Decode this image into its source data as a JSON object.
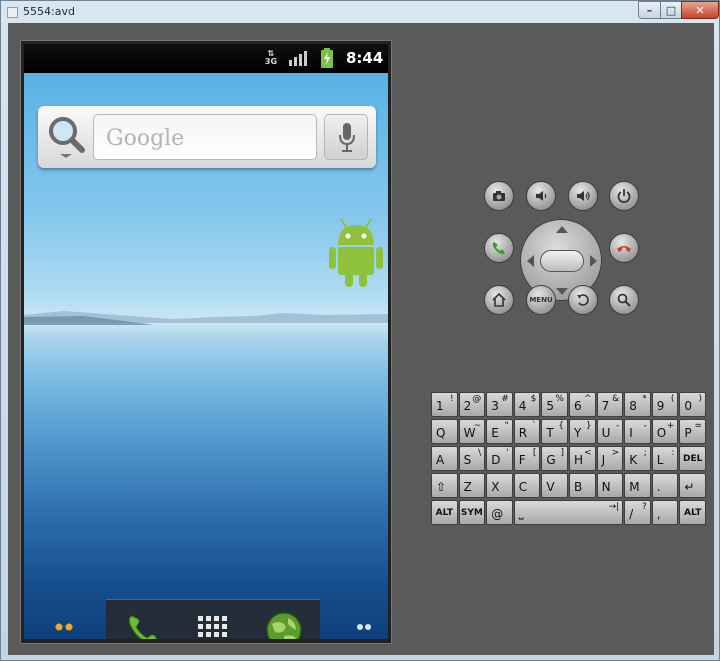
{
  "window": {
    "title": "5554:avd",
    "controls": {
      "minimize": "–",
      "maximize": "□",
      "close": "✕"
    }
  },
  "statusbar": {
    "network": "3G",
    "time": "8:44"
  },
  "search_widget": {
    "placeholder": "Google"
  },
  "hardware_buttons": {
    "menu_label": "MENU"
  },
  "keyboard": {
    "rows": [
      [
        {
          "k": "1",
          "a": "!"
        },
        {
          "k": "2",
          "a": "@"
        },
        {
          "k": "3",
          "a": "#"
        },
        {
          "k": "4",
          "a": "$"
        },
        {
          "k": "5",
          "a": "%"
        },
        {
          "k": "6",
          "a": "^"
        },
        {
          "k": "7",
          "a": "&"
        },
        {
          "k": "8",
          "a": "*"
        },
        {
          "k": "9",
          "a": "("
        },
        {
          "k": "0",
          "a": ")"
        }
      ],
      [
        {
          "k": "Q",
          "a": ""
        },
        {
          "k": "W",
          "a": "~"
        },
        {
          "k": "E",
          "a": "\""
        },
        {
          "k": "R",
          "a": "`"
        },
        {
          "k": "T",
          "a": "{"
        },
        {
          "k": "Y",
          "a": "}"
        },
        {
          "k": "U",
          "a": "-"
        },
        {
          "k": "I",
          "a": "-"
        },
        {
          "k": "O",
          "a": "+"
        },
        {
          "k": "P",
          "a": "="
        }
      ],
      [
        {
          "k": "A",
          "a": ""
        },
        {
          "k": "S",
          "a": "\\"
        },
        {
          "k": "D",
          "a": "'"
        },
        {
          "k": "F",
          "a": "["
        },
        {
          "k": "G",
          "a": "]"
        },
        {
          "k": "H",
          "a": "<"
        },
        {
          "k": "J",
          "a": ">"
        },
        {
          "k": "K",
          "a": ";"
        },
        {
          "k": "L",
          "a": ":"
        },
        {
          "k": "DEL",
          "a": ""
        }
      ],
      [
        {
          "k": "⇧",
          "a": ""
        },
        {
          "k": "Z",
          "a": ""
        },
        {
          "k": "X",
          "a": ""
        },
        {
          "k": "C",
          "a": ""
        },
        {
          "k": "V",
          "a": ""
        },
        {
          "k": "B",
          "a": ""
        },
        {
          "k": "N",
          "a": ""
        },
        {
          "k": "M",
          "a": ""
        },
        {
          "k": ".",
          "a": ""
        },
        {
          "k": "↵",
          "a": ""
        }
      ],
      [
        {
          "k": "ALT",
          "a": ""
        },
        {
          "k": "SYM",
          "a": ""
        },
        {
          "k": "@",
          "a": ""
        },
        {
          "k": "⎵",
          "a": "→|"
        },
        {
          "k": "/",
          "a": "?"
        },
        {
          "k": ",",
          "a": ""
        },
        {
          "k": "ALT",
          "a": ""
        }
      ]
    ]
  },
  "colors": {
    "emulator_panel": "#5a5a5a",
    "wallpaper_sky": "#58b2e4",
    "android_green": "#8fc23c",
    "end_call_red": "#d53a2c",
    "call_green": "#3c9b2f"
  }
}
